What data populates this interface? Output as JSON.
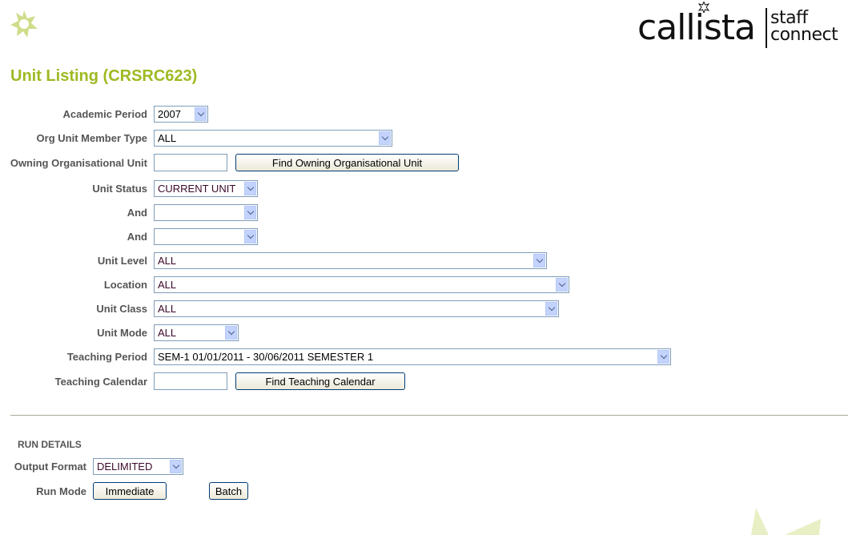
{
  "brand": {
    "name": "callista",
    "product_line1": "staff",
    "product_line2": "connect"
  },
  "page_title": "Unit Listing (CRSRC623)",
  "form": {
    "academic_period": {
      "label": "Academic Period",
      "value": "2007"
    },
    "org_unit_member_type": {
      "label": "Org Unit Member Type",
      "value": "ALL"
    },
    "owning_org_unit": {
      "label": "Owning Organisational Unit",
      "value": "",
      "button": "Find Owning Organisational Unit"
    },
    "unit_status": {
      "label": "Unit Status",
      "value": "CURRENT UNIT"
    },
    "and1": {
      "label": "And",
      "value": ""
    },
    "and2": {
      "label": "And",
      "value": ""
    },
    "unit_level": {
      "label": "Unit Level",
      "value": "ALL"
    },
    "location": {
      "label": "Location",
      "value": "ALL"
    },
    "unit_class": {
      "label": "Unit Class",
      "value": "ALL"
    },
    "unit_mode": {
      "label": "Unit Mode",
      "value": "ALL"
    },
    "teaching_period": {
      "label": "Teaching Period",
      "value": "SEM-1 01/01/2011 - 30/06/2011 SEMESTER 1"
    },
    "teaching_calendar": {
      "label": "Teaching Calendar",
      "value": "",
      "button": "Find Teaching Calendar"
    }
  },
  "run_details": {
    "title": "RUN DETAILS",
    "output_format": {
      "label": "Output Format",
      "value": "DELIMITED"
    },
    "run_mode": {
      "label": "Run Mode",
      "immediate": "Immediate",
      "batch": "Batch"
    }
  },
  "colors": {
    "accent": "#9dba22",
    "label": "#555555",
    "input_border": "#7f9db9"
  }
}
